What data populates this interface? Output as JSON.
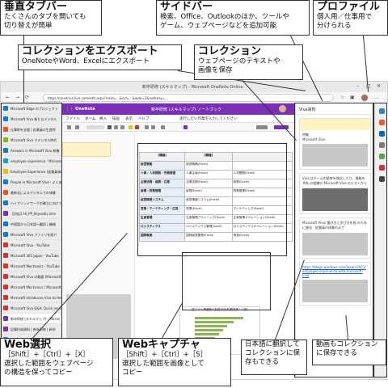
{
  "callouts": {
    "vtabs": {
      "title": "垂直タブバー",
      "desc1": "たくさんのタブを開いても",
      "desc2": "切り替えが簡単"
    },
    "sidebar": {
      "title": "サイドバー",
      "desc1": "検索、Office、Outlookのほか、ツールや",
      "desc2": "ゲーム、ウェブページなどを追加可能"
    },
    "profile": {
      "title": "プロファイル",
      "desc1": "個人用／仕事用で",
      "desc2": "分けられる"
    },
    "export": {
      "title": "コレクションをエクスポート",
      "desc1": "OneNoteやWord、Excelにエクスポート"
    },
    "collection": {
      "title": "コレクション",
      "desc1": "ウェブページのテキストや",
      "desc2": "画像を保存"
    },
    "webselect": {
      "title": "Web選択",
      "desc1": "［Shift］+［Ctrl］+［X］",
      "desc2": "選択した範囲をウェブページ",
      "desc3": "の構造を保ってコピー"
    },
    "webcapture": {
      "title": "Webキャプチャ",
      "desc1": "［Shift］+［Ctrl］+［S］",
      "desc2": "選択した範囲を画像として",
      "desc3": "コピー"
    },
    "translate": {
      "desc1": "日本語に翻訳して",
      "desc2": "コレクションに保",
      "desc3": "存もできる"
    },
    "video": {
      "desc1": "動画もコレクション",
      "desc2": "に保存できる"
    }
  },
  "browser": {
    "window_title": "新卒研修 (スキルマップ) - Microsoft OneNote Online",
    "url": "https://onedrive.live.com/edit.aspx?resid=...&cid=...&wdo=2&authkey=...",
    "tabs": [
      {
        "label": "Microsoft Edge のプロジェクト",
        "color": "#0c7ad6"
      },
      {
        "label": "Microsoft Viva 新たなデジタル",
        "color": "#0c7ad6"
      },
      {
        "label": "仕事術を支援 | 従業員の生産性",
        "color": "#f25022"
      },
      {
        "label": "Microsoft Viva でデジタル時代",
        "color": "#7fba00"
      },
      {
        "label": "Answers in Microsoft Viva 新機",
        "color": "#0c7ad6"
      },
      {
        "label": "employee experience - Microsoft",
        "color": "#00a4ef"
      },
      {
        "label": "Employee Experience (従業員体験)",
        "color": "#ffb900"
      },
      {
        "label": "People in Microsoft Viva - よくあ",
        "color": "#0c7ad6"
      },
      {
        "label": "最新化によるデジタルでの体験",
        "color": "#f25022"
      },
      {
        "label": "ハイブリッドワークの確立に向けて",
        "color": "#0c7ad6"
      },
      {
        "label": "【対応】Hi_PP_Keyesdiv.ilmx",
        "color": "#7b2fb5"
      },
      {
        "label": "中国語から日本語へ翻訳 | 機械",
        "color": "#0c7ad6"
      },
      {
        "label": "Microsoft Viva ファミリを紹介",
        "color": "#0c7ad6"
      },
      {
        "label": "Microsoft Viva - YouTube",
        "color": "#e52d27"
      },
      {
        "label": "Microsoft 365 Japan - YouTube",
        "color": "#e52d27"
      },
      {
        "label": "Microsoft Mechanics - YouTube",
        "color": "#e52d27"
      },
      {
        "label": "Microsoft Viva の概要 (Microsoft)",
        "color": "#e52d27"
      },
      {
        "label": "Microsoft Mechanics / Microsoft",
        "color": "#e52d27"
      },
      {
        "label": "Microsoft Introduces Viva to Hel",
        "color": "#e52d27"
      },
      {
        "label": "Microsoft Viva Q&A: Quick reco",
        "color": "#e52d27"
      },
      {
        "label": "新卒研修 (スキルマップ) - Micros",
        "color": "#7b2fb5"
      },
      {
        "label": "記事作成資料 | 新卒研修 | 新卒",
        "color": "#7b2fb5"
      },
      {
        "label": "社員教育 | 【特集】ビジネスプラ",
        "color": "#0c7ad6"
      },
      {
        "label": "社員教育 - 検索",
        "color": "#0c7ad6"
      }
    ]
  },
  "onenote": {
    "app_name": "OneNote",
    "doc_title": "新卒研修 (スキルマップ) ノートブック",
    "menu": [
      "ファイル",
      "ホーム",
      "挿入",
      "描画",
      "表示",
      "ヘルプ"
    ],
    "tellme": "実行したい作業を入力してください",
    "table": {
      "headers": [
        "[職種]",
        "[職種]"
      ],
      "rows": [
        {
          "cat": "経営戦略",
          "a": "経営戦略(Excel)",
          "b": ""
        },
        {
          "cat": "人事・人材開発・労務管理",
          "a": "人事企画(Excel)",
          "b": "人材開発(Excel)"
        },
        {
          "cat": "企業法務・総務・広報",
          "a": "企業法務(Excel)",
          "b": "総務(Excel)"
        },
        {
          "cat": "経理・財務管理",
          "a": "経理(Excel)",
          "b": "財務管理(Excel)"
        },
        {
          "cat": "経営情報システム",
          "a": "経営情報システム(Excel)",
          "b": ""
        },
        {
          "cat": "営業・マーケティング・広告",
          "a": "営業(Excel)",
          "b": "マーケティング(Excel)"
        },
        {
          "cat": "生産管理",
          "a": "生産管理プランニング(Excel)",
          "b": "生産管理オペレーション(Excel)"
        },
        {
          "cat": "ロジスティクス",
          "a": "ロジスティクス管理(Excel)",
          "b": "ロジスティクスオペレーション(Excel)"
        },
        {
          "cat": "国際事業",
          "a": "国際経営管理(Excel)",
          "b": "貿易(Excel)"
        }
      ]
    },
    "chart_caption": "図 3.5.5 職種別の回答状況(従業員数・人数)"
  },
  "viva": {
    "header": "Viva資料",
    "card1_label": "特集",
    "card1_text": "Microsoft Viva",
    "card2_text": "Viva はチームの結束を強化したり、情報を共有 の組織の Microsoft Viva のテストから",
    "card3_text": "Microsoft Viva: 働き方と学び方を前 のために進化 - 従業員の体験のまで",
    "url_text": "https://blogs.windows.com/japan/2021/ employee-experience-with-microsoft-viva"
  }
}
